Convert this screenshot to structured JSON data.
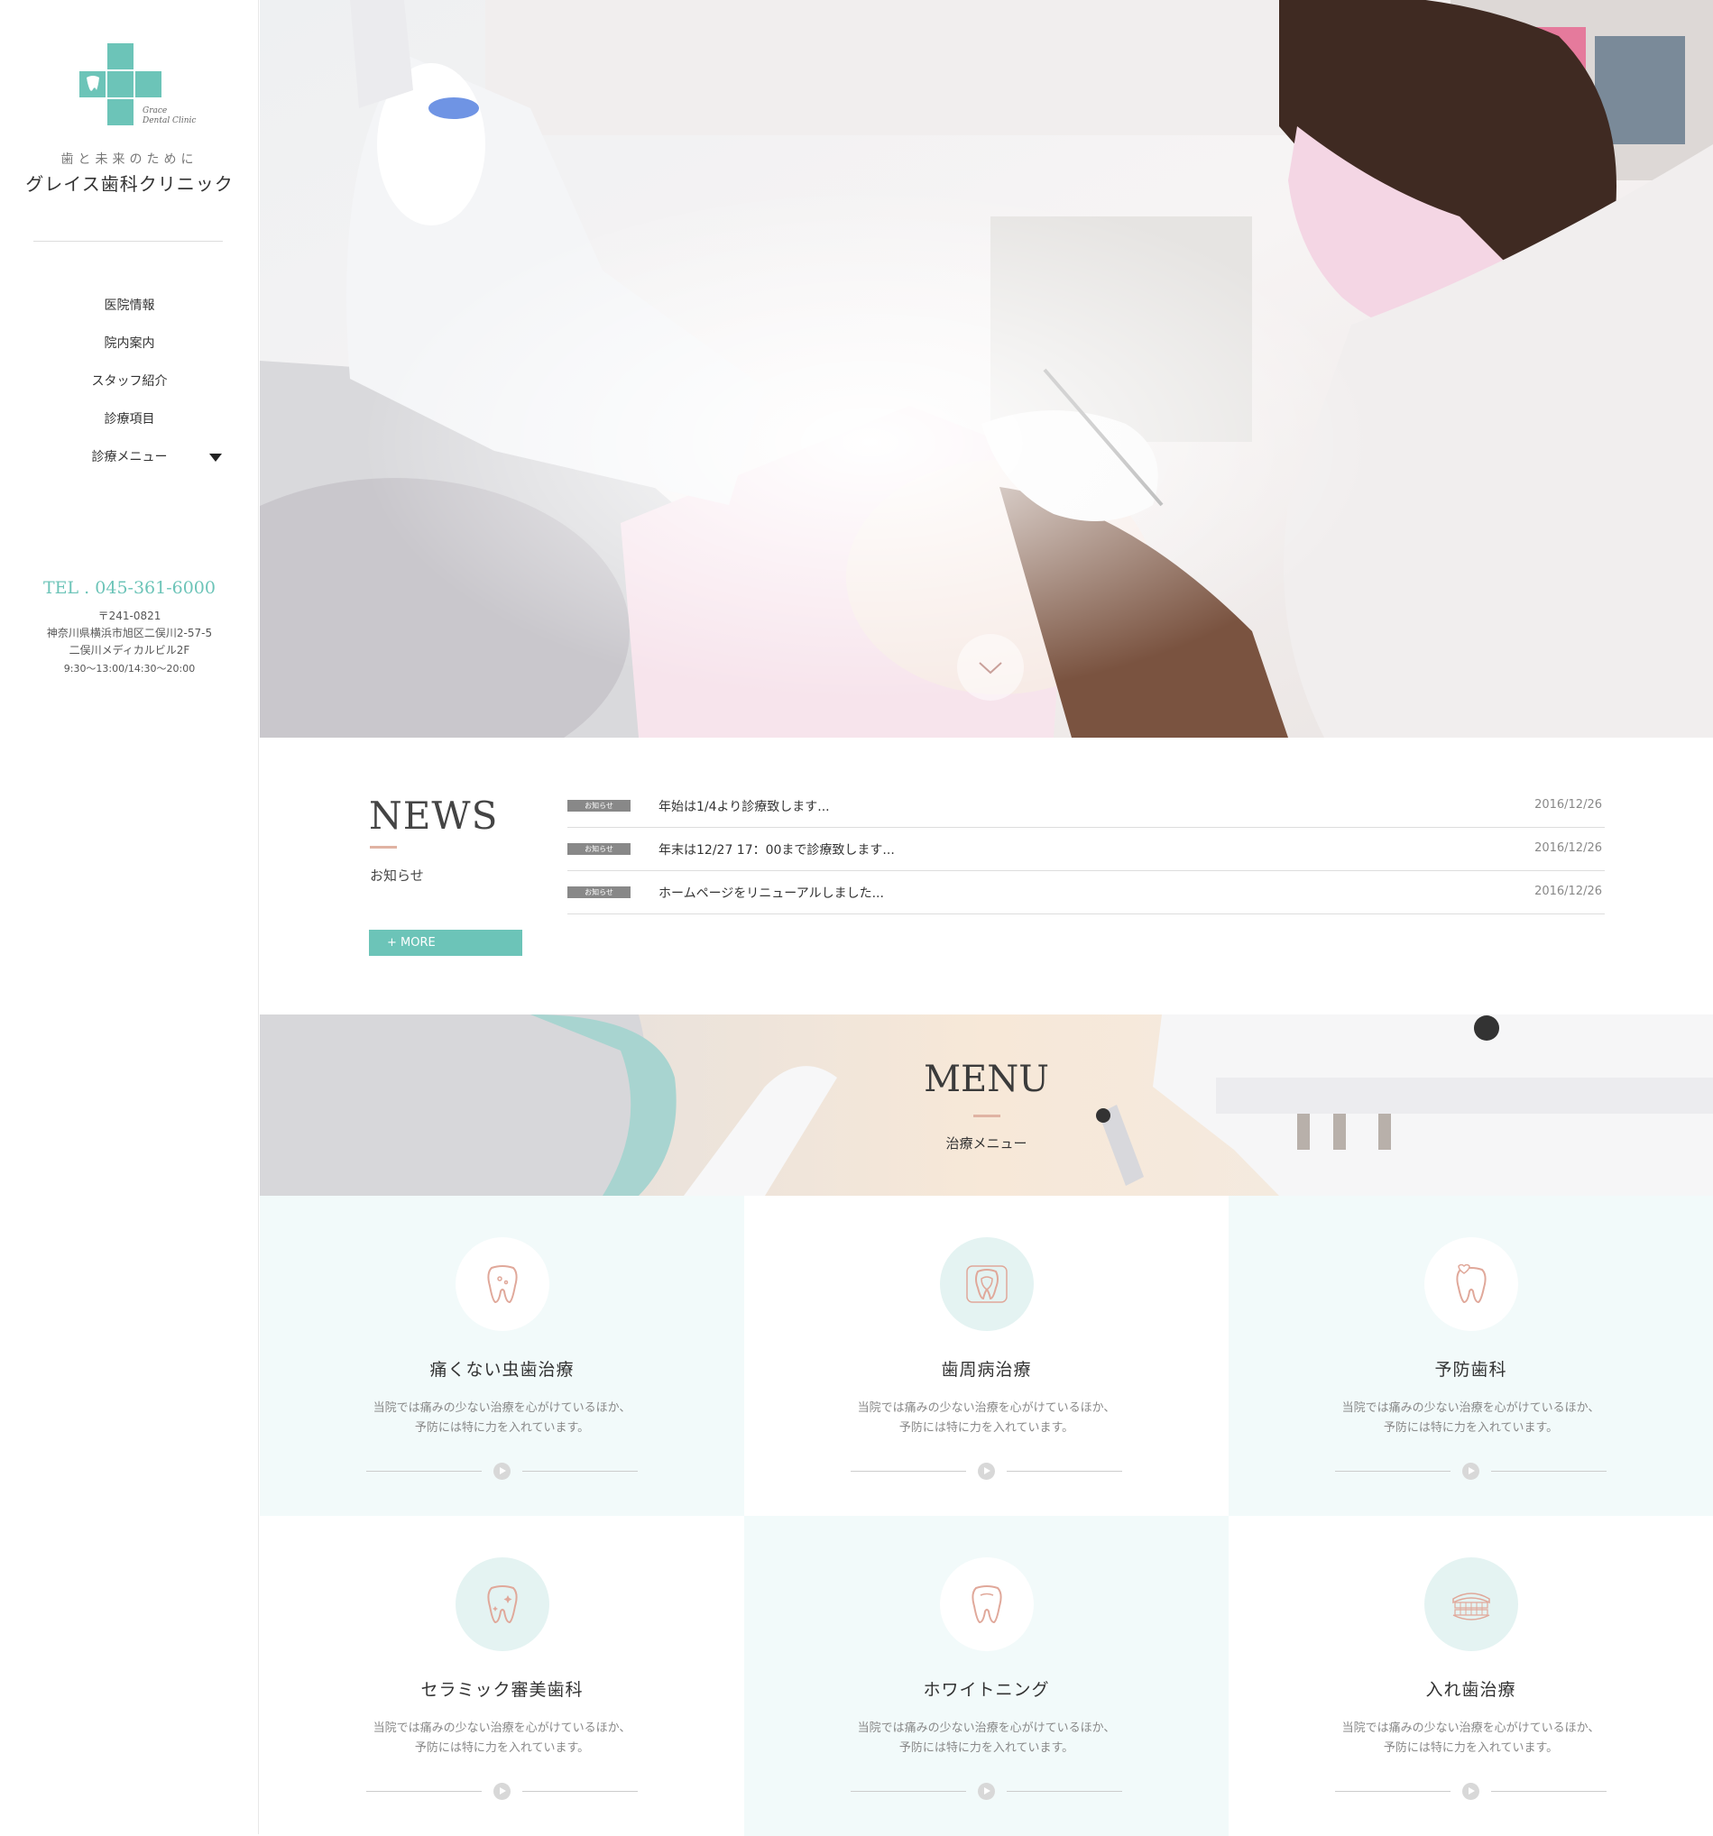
{
  "sidebar": {
    "logo_text": [
      "Grace",
      "Dental Clinic"
    ],
    "tagline": "歯と未来のために",
    "clinic_name": "グレイス歯科クリニック",
    "nav": [
      {
        "label": "医院情報"
      },
      {
        "label": "院内案内"
      },
      {
        "label": "スタッフ紹介"
      },
      {
        "label": "診療項目"
      },
      {
        "label": "診療メニュー"
      }
    ],
    "tel": "TEL . 045-361-6000",
    "postal": "〒241-0821",
    "address1": "神奈川県横浜市旭区二俣川2-57-5",
    "address2": "二俣川メディカルビル2F",
    "hours": "9:30～13:00/14:30～20:00"
  },
  "news": {
    "title": "NEWS",
    "subtitle": "お知らせ",
    "more_label": "+ MORE",
    "items": [
      {
        "tag": "お知らせ",
        "text": "年始は1/4より診療致します...",
        "date": "2016/12/26"
      },
      {
        "tag": "お知らせ",
        "text": "年末は12/27 17：00まで診療致します...",
        "date": "2016/12/26"
      },
      {
        "tag": "お知らせ",
        "text": "ホームページをリニューアルしました...",
        "date": "2016/12/26"
      }
    ]
  },
  "menu": {
    "title": "MENU",
    "subtitle": "治療メニュー",
    "items": [
      {
        "title": "痛くない虫歯治療",
        "line1": "当院では痛みの少ない治療を心がけているほか、",
        "line2": "予防には特に力を入れています。",
        "icon": "tooth-cavity-icon"
      },
      {
        "title": "歯周病治療",
        "line1": "当院では痛みの少ない治療を心がけているほか、",
        "line2": "予防には特に力を入れています。",
        "icon": "tooth-gum-icon"
      },
      {
        "title": "予防歯科",
        "line1": "当院では痛みの少ない治療を心がけているほか、",
        "line2": "予防には特に力を入れています。",
        "icon": "tooth-heart-icon"
      },
      {
        "title": "セラミック審美歯科",
        "line1": "当院では痛みの少ない治療を心がけているほか、",
        "line2": "予防には特に力を入れています。",
        "icon": "tooth-sparkle-icon"
      },
      {
        "title": "ホワイトニング",
        "line1": "当院では痛みの少ない治療を心がけているほか、",
        "line2": "予防には特に力を入れています。",
        "icon": "tooth-white-icon"
      },
      {
        "title": "入れ歯治療",
        "line1": "当院では痛みの少ない治療を心がけているほか、",
        "line2": "予防には特に力を入れています。",
        "icon": "denture-icon"
      }
    ]
  },
  "colors": {
    "accent": "#6cc4b8",
    "pink": "#e0b3a3",
    "card_tint": "#f2fafa",
    "icon_circle_tint": "#e4f3f2"
  }
}
